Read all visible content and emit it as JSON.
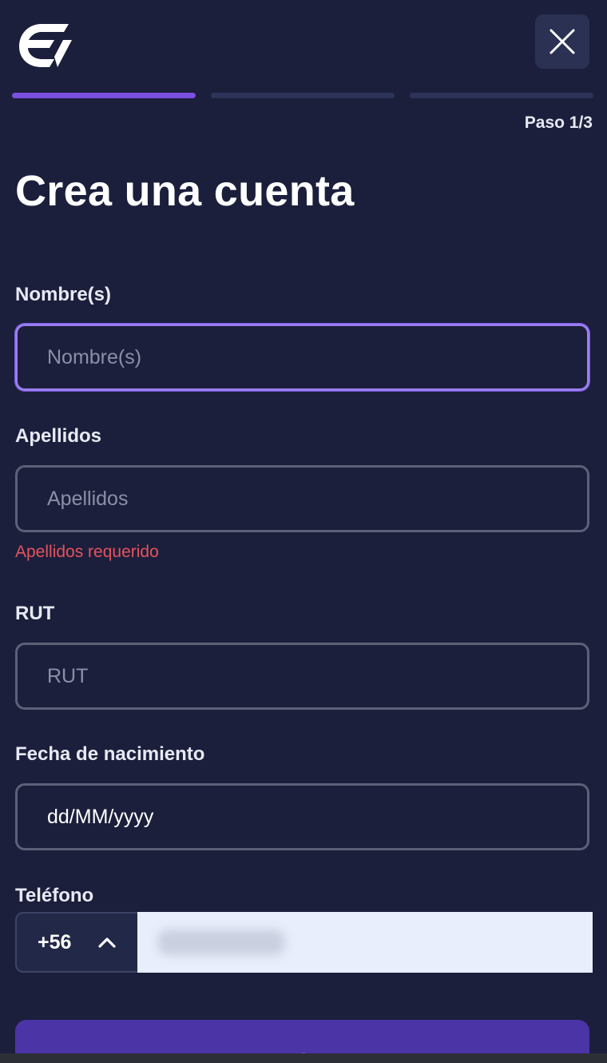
{
  "header": {
    "logo_icon": "ev-brand-logo-icon",
    "close_icon": "close-icon"
  },
  "progress": {
    "current_step": 1,
    "total_steps": 3,
    "step_label": "Paso 1/3",
    "active_color": "#7b4fe0",
    "inactive_color": "#2c3358"
  },
  "title": "Crea una cuenta",
  "form": {
    "first_name": {
      "label": "Nombre(s)",
      "placeholder": "Nombre(s)",
      "value": ""
    },
    "last_name": {
      "label": "Apellidos",
      "placeholder": "Apellidos",
      "value": "",
      "error": "Apellidos requerido"
    },
    "rut": {
      "label": "RUT",
      "placeholder": "RUT",
      "value": ""
    },
    "birth_date": {
      "label": "Fecha de nacimiento",
      "value": "dd/MM/yyyy"
    },
    "phone": {
      "label": "Teléfono",
      "country_code": "+56",
      "chevron_icon": "chevron-up-icon"
    }
  },
  "continue_label": "Continuar",
  "colors": {
    "background": "#1b1f3b",
    "accent": "#7b4fe0",
    "error": "#e5535e",
    "button": "#4b34a6"
  }
}
